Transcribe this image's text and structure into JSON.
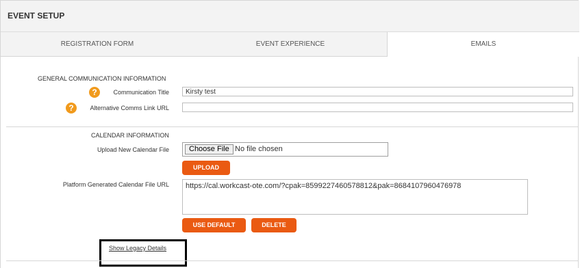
{
  "header": {
    "title": "EVENT SETUP"
  },
  "tabs": [
    {
      "label": "REGISTRATION FORM",
      "active": false
    },
    {
      "label": "EVENT EXPERIENCE",
      "active": false
    },
    {
      "label": "EMAILS",
      "active": true
    }
  ],
  "general": {
    "heading": "GENERAL COMMUNICATION INFORMATION",
    "comm_title_label": "Communication Title",
    "comm_title_value": "Kirsty test",
    "alt_link_label": "Alternative Comms Link URL",
    "alt_link_value": "",
    "help_glyph": "?"
  },
  "calendar": {
    "heading": "CALENDAR INFORMATION",
    "upload_label": "Upload New Calendar File",
    "choose_file_label": "Choose File",
    "no_file_text": "No file chosen",
    "upload_button": "UPLOAD",
    "platform_label": "Platform Generated Calendar File URL",
    "platform_value": "https://cal.workcast-ote.com/?cpak=8599227460578812&pak=8684107960476978",
    "use_default_button": "USE DEFAULT",
    "delete_button": "DELETE"
  },
  "legacy_link": "Show Legacy Details",
  "colors": {
    "accent": "#ea5a12",
    "help": "#f19a1c"
  },
  "icons": {
    "help": "question-circle-icon"
  }
}
